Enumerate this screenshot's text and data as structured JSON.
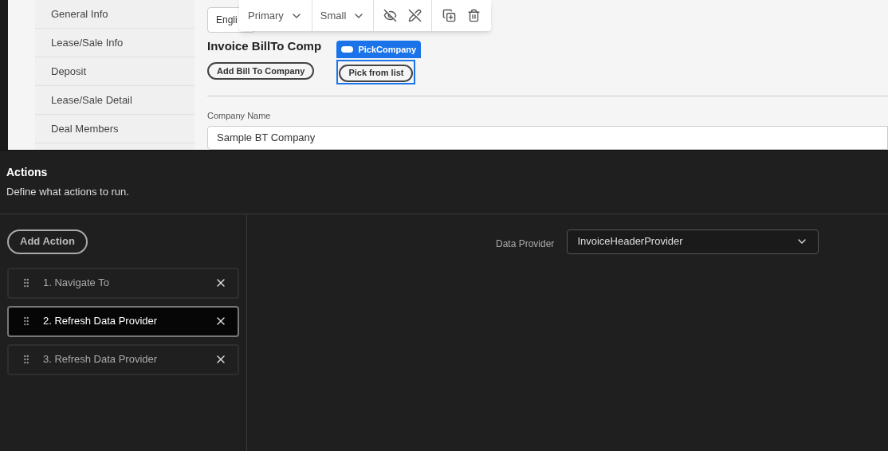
{
  "preview": {
    "sidebar_items": [
      {
        "label": "General Info",
        "selected": false
      },
      {
        "label": "Lease/Sale Info",
        "selected": false
      },
      {
        "label": "Deposit",
        "selected": false
      },
      {
        "label": "Lease/Sale Detail",
        "selected": false
      },
      {
        "label": "Deal Members",
        "selected": false
      }
    ],
    "language_select": "Engli",
    "toolbar": {
      "variant": "Primary",
      "size": "Small"
    },
    "section_title": "Invoice BillTo Comp",
    "buttons": [
      {
        "label": "Add Bill To Company",
        "selected": false
      },
      {
        "label": "Pick from list",
        "selected": true,
        "tag": "PickCompany"
      }
    ],
    "field": {
      "label": "Company Name",
      "value": "Sample BT Company"
    }
  },
  "actions": {
    "title": "Actions",
    "description": "Define what actions to run.",
    "add_button": "Add Action",
    "items": [
      {
        "label": "1. Navigate To",
        "selected": false
      },
      {
        "label": "2. Refresh Data Provider",
        "selected": true
      },
      {
        "label": "3. Refresh Data Provider",
        "selected": false
      }
    ],
    "properties": {
      "label": "Data Provider",
      "value": "InvoiceHeaderProvider"
    }
  }
}
